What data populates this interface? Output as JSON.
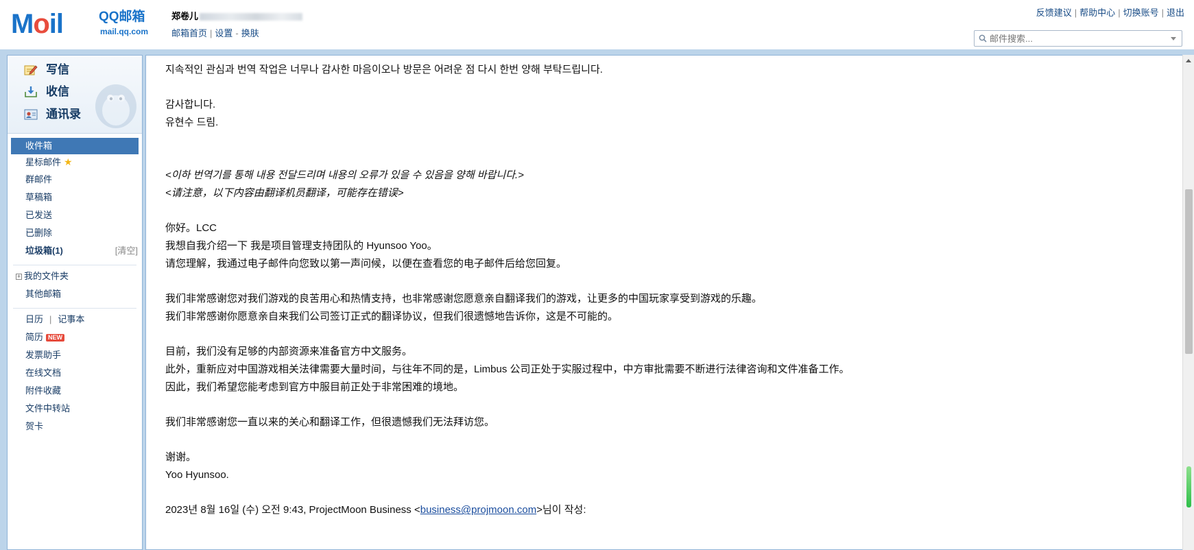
{
  "header": {
    "logo_text_m": "M",
    "logo_text_o": "o",
    "logo_text_il": "il",
    "brand": "QQ邮箱",
    "domain": "mail.qq.com",
    "user_name": "郑卷儿",
    "links": [
      "邮箱首页",
      "设置",
      "换肤"
    ],
    "top_links": [
      "反馈建议",
      "帮助中心",
      "切换账号",
      "退出"
    ],
    "search_placeholder": "邮件搜索..."
  },
  "sidebar": {
    "quick": [
      {
        "label": "写信",
        "icon": "pencil-icon"
      },
      {
        "label": "收信",
        "icon": "inbox-download-icon"
      },
      {
        "label": "通讯录",
        "icon": "contacts-icon"
      }
    ],
    "folders": [
      {
        "label": "收件箱",
        "active": true
      },
      {
        "label": "星标邮件"
      },
      {
        "label": "群邮件"
      },
      {
        "label": "草稿箱"
      },
      {
        "label": "已发送"
      },
      {
        "label": "已删除"
      },
      {
        "label": "垃圾箱(1)",
        "clear": "[清空]"
      }
    ],
    "tree": [
      {
        "label": "我的文件夹"
      },
      {
        "label": "其他邮箱"
      }
    ],
    "tools_row": {
      "left": "日历",
      "sep": "|",
      "right": "记事本"
    },
    "tools": [
      {
        "label": "简历",
        "badge": "NEW"
      },
      {
        "label": "发票助手"
      },
      {
        "label": "在线文档"
      },
      {
        "label": "附件收藏"
      },
      {
        "label": "文件中转站"
      },
      {
        "label": "贺卡"
      }
    ]
  },
  "mail": {
    "lines": [
      "지속적인 관심과 번역 작업은 너무나 감사한 마음이오나 방문은 어려운 점 다시 한번 양해 부탁드립니다.",
      "",
      "감사합니다.",
      "유현수 드림.",
      "",
      "",
      "<이하 번역기를 통해 내용 전달드리며 내용의 오류가 있을 수 있음을 양해 바랍니다.>",
      "<请注意，以下内容由翻译机员翻译，可能存在错误>",
      "",
      "你好。LCC",
      "我想自我介绍一下 我是项目管理支持团队的 Hyunsoo Yoo。",
      "请您理解，我通过电子邮件向您致以第一声问候，以便在查看您的电子邮件后给您回复。",
      "",
      "我们非常感谢您对我们游戏的良苦用心和热情支持，也非常感谢您愿意亲自翻译我们的游戏，让更多的中国玩家享受到游戏的乐趣。",
      "我们非常感谢你愿意亲自来我们公司签订正式的翻译协议，但我们很遗憾地告诉你，这是不可能的。",
      "",
      "目前，我们没有足够的内部资源来准备官方中文服务。",
      "此外，重新应对中国游戏相关法律需要大量时间，与往年不同的是，Limbus 公司正处于实服过程中，中方审批需要不断进行法律咨询和文件准备工作。",
      "因此，我们希望您能考虑到官方中服目前正处于非常困难的境地。",
      "",
      "我们非常感谢您一直以来的关心和翻译工作，但很遗憾我们无法拜访您。",
      "",
      "谢谢。",
      "Yoo Hyunsoo.",
      ""
    ],
    "quote_prefix": "2023년 8월 16일 (수) 오전 9:43, ProjectMoon Business <",
    "quote_email": "business@projmoon.com",
    "quote_suffix": ">님이 작성:"
  },
  "colors": {
    "brand_blue": "#1a73c9",
    "frame_bg": "#bcd4ea",
    "active_folder": "#3f78b5"
  }
}
